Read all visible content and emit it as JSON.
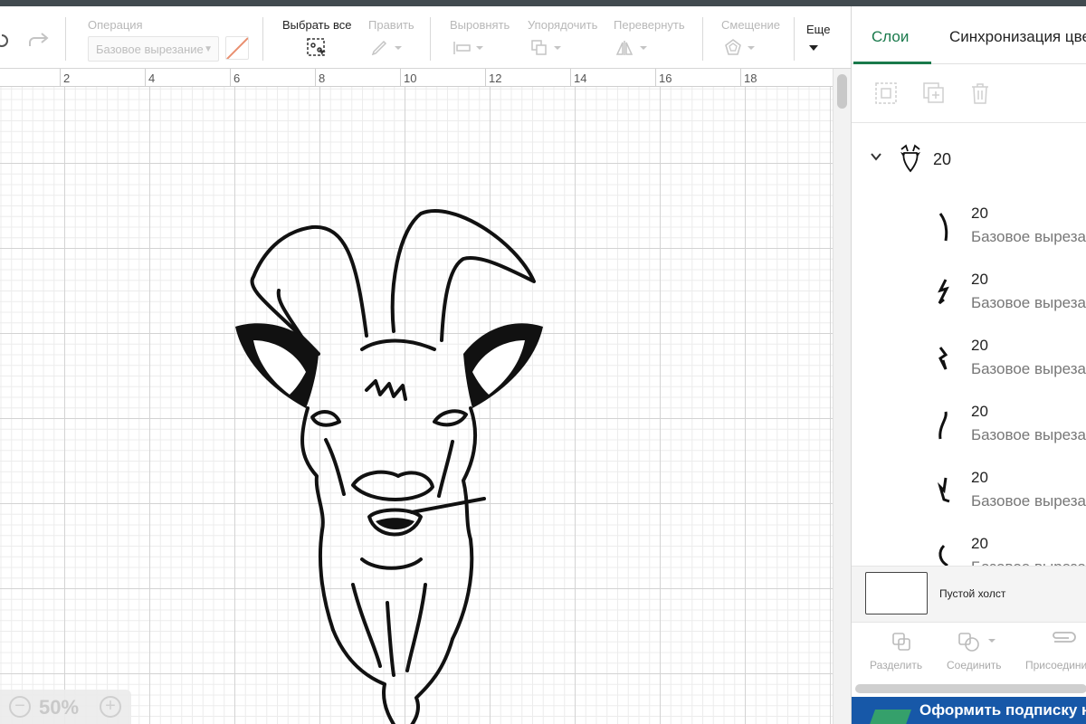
{
  "toolbar": {
    "operation_label": "Операция",
    "operation_value": "Базовое вырезание",
    "select_all_label": "Выбрать все",
    "edit_label": "Править",
    "align_label": "Выровнять",
    "arrange_label": "Упорядочить",
    "flip_label": "Перевернуть",
    "offset_label": "Смещение",
    "more_label": "Еще"
  },
  "ruler": {
    "labels": [
      "2",
      "4",
      "6",
      "8",
      "10",
      "12",
      "14",
      "16",
      "18"
    ]
  },
  "zoom": {
    "value": "50%",
    "minus": "−",
    "plus": "+"
  },
  "panel": {
    "tabs": [
      "Слои",
      "Синхронизация цвета"
    ],
    "group": {
      "name": "20"
    },
    "layers": [
      {
        "name": "20",
        "sub": "Базовое вырезание"
      },
      {
        "name": "20",
        "sub": "Базовое вырезание"
      },
      {
        "name": "20",
        "sub": "Базовое вырезание"
      },
      {
        "name": "20",
        "sub": "Базовое вырезание"
      },
      {
        "name": "20",
        "sub": "Базовое вырезание"
      },
      {
        "name": "20",
        "sub": "Базовое вырезание"
      }
    ],
    "blank_canvas": "Пустой холст",
    "actions": [
      "Разделить",
      "Соединить",
      "Присоединить"
    ],
    "promo": "Оформить подписку на Cricut Access"
  },
  "colors": {
    "accent": "#1a7a4c",
    "promo_bg": "#1758a8",
    "promo_badge": "#35a06b"
  }
}
